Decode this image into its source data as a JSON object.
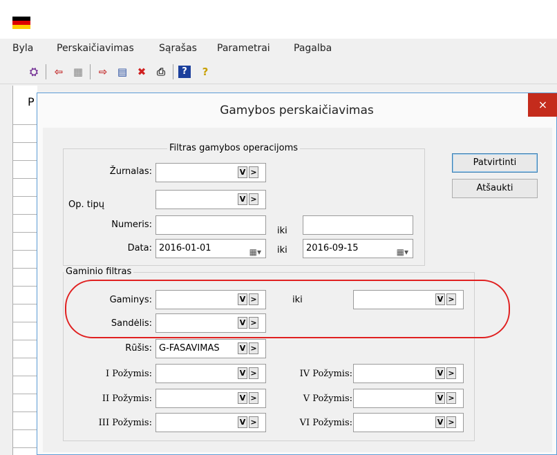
{
  "menu": [
    "Byla",
    "Perskaičiavimas",
    "Sąrašas",
    "Parametrai",
    "Pagalba"
  ],
  "background": {
    "column_header": "P"
  },
  "dialog": {
    "title": "Gamybos perskaičiavimas",
    "close_label": "×",
    "confirm_label": "Patvirtinti",
    "cancel_label": "Atšaukti",
    "operations_filter": {
      "legend": "Filtras gamybos operacijoms",
      "journal_label": "Žurnalas:",
      "journal_value": "",
      "optype_label": "Op. tipų",
      "optype_value": "",
      "number_label": "Numeris:",
      "number_from": "",
      "number_to": "",
      "date_label": "Data:",
      "date_from": "2016-01-01",
      "date_to": "2016-09-15",
      "iki": "iki"
    },
    "product_filter": {
      "legend": "Gaminio filtras",
      "product_label": "Gaminys:",
      "product_from": "",
      "product_to": "",
      "warehouse_label": "Sandėlis:",
      "warehouse_value": "",
      "kind_label": "Rūšis:",
      "kind_value": "G-FASAVIMAS",
      "attr1_label": "I Požymis:",
      "attr2_label": "II Požymis:",
      "attr3_label": "III Požymis:",
      "attr4_label": "IV Požymis:",
      "attr5_label": "V Požymis:",
      "attr6_label": "VI Požymis:",
      "iki": "iki"
    },
    "drop_glyph": "V",
    "next_glyph": ">"
  }
}
